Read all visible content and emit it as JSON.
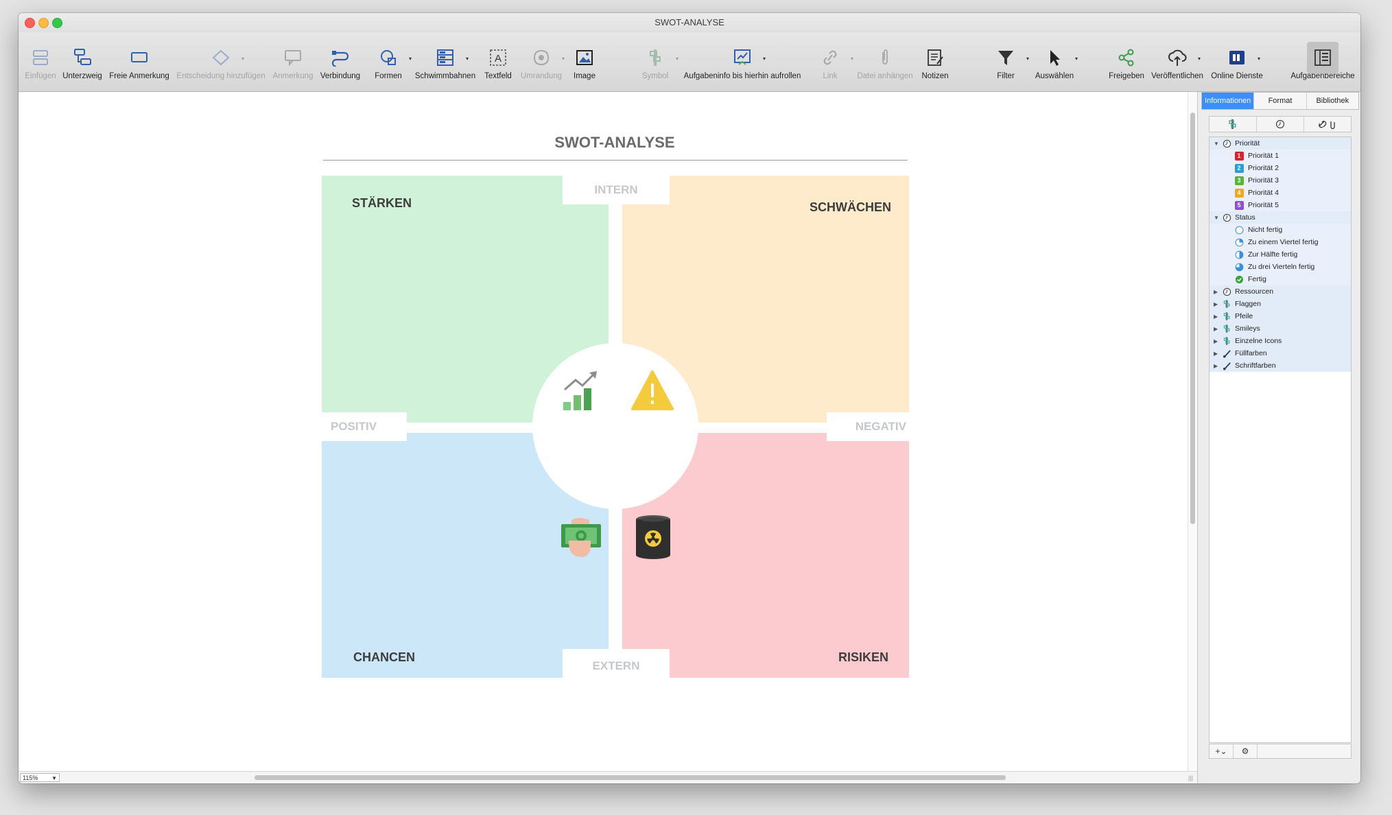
{
  "window": {
    "title": "SWOT-ANALYSE"
  },
  "toolbar": [
    {
      "key": "einfuegen",
      "label": "Einfügen",
      "enabled": false,
      "icon": "insert-topic-icon",
      "dropdown": false
    },
    {
      "key": "unterzweig",
      "label": "Unterzweig",
      "enabled": true,
      "icon": "subtopic-icon",
      "dropdown": false
    },
    {
      "key": "freie-anmerkung",
      "label": "Freie Anmerkung",
      "enabled": true,
      "icon": "floating-topic-icon",
      "dropdown": false
    },
    {
      "key": "entscheidung",
      "label": "Entscheidung hinzufügen",
      "enabled": false,
      "icon": "decision-icon",
      "dropdown": true
    },
    {
      "key": "anmerkung",
      "label": "Anmerkung",
      "enabled": false,
      "icon": "callout-icon",
      "dropdown": false
    },
    {
      "key": "verbindung",
      "label": "Verbindung",
      "enabled": true,
      "icon": "relationship-icon",
      "dropdown": false
    },
    {
      "key": "formen",
      "label": "Formen",
      "enabled": true,
      "icon": "shapes-icon",
      "dropdown": true
    },
    {
      "key": "schwimmbahnen",
      "label": "Schwimmbahnen",
      "enabled": true,
      "icon": "swimlanes-icon",
      "dropdown": true
    },
    {
      "key": "textfeld",
      "label": "Textfeld",
      "enabled": true,
      "icon": "textbox-icon",
      "dropdown": false
    },
    {
      "key": "umrandung",
      "label": "Umrandung",
      "enabled": false,
      "icon": "boundary-icon",
      "dropdown": true
    },
    {
      "key": "image",
      "label": "Image",
      "enabled": true,
      "icon": "image-icon",
      "dropdown": false
    },
    {
      "key": "symbol",
      "label": "Symbol",
      "enabled": false,
      "icon": "symbol-icon",
      "dropdown": true
    },
    {
      "key": "aufgabeninfo",
      "label": "Aufgabeninfo bis hierhin aufrollen",
      "enabled": true,
      "icon": "roll-up-task-info-icon",
      "dropdown": true
    },
    {
      "key": "link",
      "label": "Link",
      "enabled": false,
      "icon": "link-icon",
      "dropdown": true
    },
    {
      "key": "datei",
      "label": "Datei anhängen",
      "enabled": false,
      "icon": "attach-file-icon",
      "dropdown": false
    },
    {
      "key": "notizen",
      "label": "Notizen",
      "enabled": true,
      "icon": "notes-icon",
      "dropdown": false
    },
    {
      "key": "filter",
      "label": "Filter",
      "enabled": true,
      "icon": "filter-icon",
      "dropdown": true
    },
    {
      "key": "auswaehlen",
      "label": "Auswählen",
      "enabled": true,
      "icon": "select-cursor-icon",
      "dropdown": true
    },
    {
      "key": "freigeben",
      "label": "Freigeben",
      "enabled": true,
      "icon": "share-icon",
      "dropdown": false
    },
    {
      "key": "veroeffentlichen",
      "label": "Veröffentlichen",
      "enabled": true,
      "icon": "publish-cloud-icon",
      "dropdown": true
    },
    {
      "key": "online-dienste",
      "label": "Online Dienste",
      "enabled": true,
      "icon": "online-services-icon",
      "dropdown": true
    },
    {
      "key": "aufgabenbereiche",
      "label": "Aufgabenbereiche",
      "enabled": true,
      "icon": "task-panes-icon",
      "dropdown": false,
      "selected": true
    }
  ],
  "diagram": {
    "title": "SWOT-ANALYSE",
    "axis": {
      "top": "INTERN",
      "bottom": "EXTERN",
      "left": "POSITIV",
      "right": "NEGATIV"
    },
    "quadrants": {
      "strengths": {
        "label": "STÄRKEN",
        "color": "#cff2d8"
      },
      "weaknesses": {
        "label": "SCHWÄCHEN",
        "color": "#fdebcc"
      },
      "opportunities": {
        "label": "CHANCEN",
        "color": "#cce7f8"
      },
      "threats": {
        "label": "RISIKEN",
        "color": "#fccbd0"
      }
    },
    "center_icons": [
      "growth-chart-icon",
      "warning-triangle-icon",
      "money-hand-icon",
      "radioactive-barrel-icon"
    ]
  },
  "panel": {
    "tabs": [
      {
        "label": "Informationen",
        "active": true
      },
      {
        "label": "Format",
        "active": false
      },
      {
        "label": "Bibliothek",
        "active": false
      }
    ],
    "subtabs": [
      "symbols-icon",
      "clock-icon",
      "link-attach-icon"
    ],
    "groups": [
      {
        "label": "Priorität",
        "expanded": true,
        "icon": "clock-icon",
        "items": [
          {
            "label": "Priorität 1",
            "num": "1",
            "color": "#d8232a"
          },
          {
            "label": "Priorität 2",
            "num": "2",
            "color": "#2a9cd8"
          },
          {
            "label": "Priorität 3",
            "num": "3",
            "color": "#5ab332"
          },
          {
            "label": "Priorität 4",
            "num": "4",
            "color": "#f2a71e"
          },
          {
            "label": "Priorität 5",
            "num": "5",
            "color": "#8e4fd6"
          }
        ]
      },
      {
        "label": "Status",
        "expanded": true,
        "icon": "clock-icon",
        "items": [
          {
            "label": "Nicht fertig",
            "progress": 0
          },
          {
            "label": "Zu einem Viertel fertig",
            "progress": 0.25
          },
          {
            "label": "Zur Hälfte fertig",
            "progress": 0.5
          },
          {
            "label": "Zu drei Vierteln fertig",
            "progress": 0.75
          },
          {
            "label": "Fertig",
            "progress": 1
          }
        ]
      },
      {
        "label": "Ressourcen",
        "expanded": false,
        "icon": "clock-icon"
      },
      {
        "label": "Flaggen",
        "expanded": false,
        "icon": "symbols-icon"
      },
      {
        "label": "Pfeile",
        "expanded": false,
        "icon": "symbols-icon"
      },
      {
        "label": "Smileys",
        "expanded": false,
        "icon": "symbols-icon"
      },
      {
        "label": "Einzelne Icons",
        "expanded": false,
        "icon": "symbols-icon"
      },
      {
        "label": "Füllfarben",
        "expanded": false,
        "icon": "brush-icon"
      },
      {
        "label": "Schriftfarben",
        "expanded": false,
        "icon": "brush-icon"
      }
    ],
    "footer": [
      "add-dropdown-icon",
      "gear-icon"
    ]
  },
  "statusbar": {
    "zoom": "115%"
  }
}
